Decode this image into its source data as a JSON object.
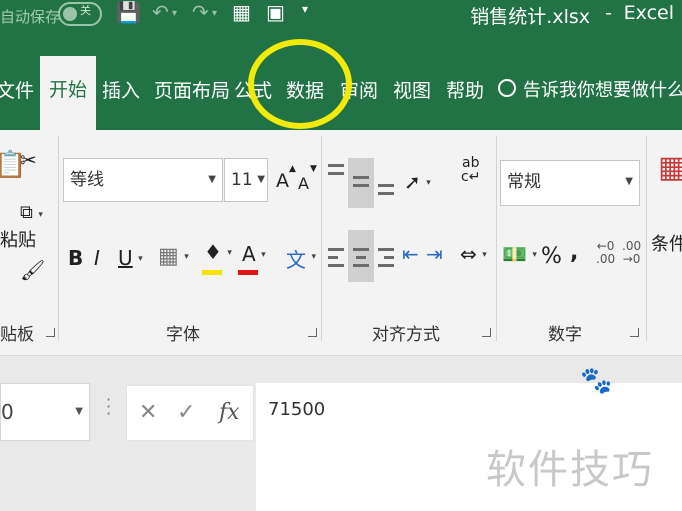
{
  "titlebar": {
    "autosave_label": "自动保存",
    "toggle_state": "关",
    "file_name": "销售统计.xlsx",
    "separator": "-",
    "app_name": "Excel"
  },
  "tabs": [
    {
      "label": "文件"
    },
    {
      "label": "开始"
    },
    {
      "label": "插入"
    },
    {
      "label": "页面布局"
    },
    {
      "label": "公式"
    },
    {
      "label": "数据"
    },
    {
      "label": "审阅"
    },
    {
      "label": "视图"
    },
    {
      "label": "帮助"
    }
  ],
  "tell_me": "告诉我你想要做什么",
  "highlight_color": "#f2ea08",
  "ribbon": {
    "clipboard": {
      "paste_label": "粘贴",
      "group_label": "贴板"
    },
    "font": {
      "font_name": "等线",
      "font_size": "11",
      "grow_label": "A",
      "shrink_label": "A",
      "bold": "B",
      "italic": "I",
      "underline": "U",
      "font_color_letter": "A",
      "fill_color": "#f5e400",
      "font_color": "#e01515",
      "phonetic_label": "文",
      "group_label": "字体"
    },
    "alignment": {
      "group_label": "对齐方式"
    },
    "number": {
      "format": "常规",
      "percent": "%",
      "comma": ",",
      "group_label": "数字"
    },
    "styles": {
      "conditional_label": "条件格"
    }
  },
  "formula_bar": {
    "name_box": "0",
    "cancel": "✕",
    "enter": "✓",
    "fx": "fx",
    "value": "71500"
  },
  "watermark": "软件技巧",
  "colors": {
    "excel_green": "#217346",
    "ribbon_bg": "#f3f3f3"
  }
}
